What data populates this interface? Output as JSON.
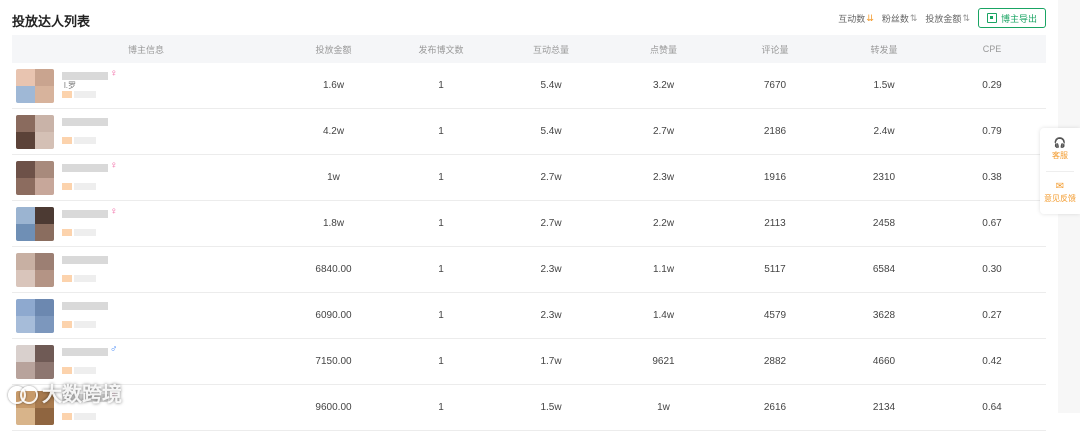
{
  "header": {
    "title": "投放达人列表",
    "sorts": [
      {
        "label": "互动数",
        "icon": "sort-desc-icon",
        "active": true
      },
      {
        "label": "粉丝数",
        "icon": "sort-icon",
        "active": false
      },
      {
        "label": "投放金额",
        "icon": "sort-icon",
        "active": false
      }
    ],
    "export_label": "博主导出"
  },
  "columns": [
    "博主信息",
    "投放金额",
    "发布博文数",
    "互动总量",
    "点赞量",
    "评论量",
    "转发量",
    "CPE"
  ],
  "rows": [
    {
      "gender": "♀",
      "name_hint": "l.罗",
      "amount": "1.6w",
      "posts": "1",
      "interactions": "5.4w",
      "likes": "3.2w",
      "comments": "7670",
      "shares": "1.5w",
      "cpe": "0.29",
      "colors": [
        "#e8c4b0",
        "#c9a48f",
        "#9fb8d6",
        "#d7b39c"
      ]
    },
    {
      "gender": "",
      "name_hint": "",
      "amount": "4.2w",
      "posts": "1",
      "interactions": "5.4w",
      "likes": "2.7w",
      "comments": "2186",
      "shares": "2.4w",
      "cpe": "0.79",
      "colors": [
        "#8a6b5e",
        "#c9b3a8",
        "#5b4238",
        "#d4c0b5"
      ]
    },
    {
      "gender": "♀",
      "name_hint": "",
      "amount": "1w",
      "posts": "1",
      "interactions": "2.7w",
      "likes": "2.3w",
      "comments": "1916",
      "shares": "2310",
      "cpe": "0.38",
      "colors": [
        "#6d5148",
        "#a88a7c",
        "#8c6c5f",
        "#c7a79a"
      ]
    },
    {
      "gender": "♀",
      "name_hint": "",
      "amount": "1.8w",
      "posts": "1",
      "interactions": "2.7w",
      "likes": "2.2w",
      "comments": "2113",
      "shares": "2458",
      "cpe": "0.67",
      "colors": [
        "#9bb4d1",
        "#4c3a33",
        "#6f8fb5",
        "#8a6d5f"
      ]
    },
    {
      "gender": "",
      "name_hint": "",
      "amount": "6840.00",
      "posts": "1",
      "interactions": "2.3w",
      "likes": "1.1w",
      "comments": "5117",
      "shares": "6584",
      "cpe": "0.30",
      "colors": [
        "#c8b0a3",
        "#9c7f73",
        "#d9c5bb",
        "#b49485"
      ]
    },
    {
      "gender": "",
      "name_hint": "",
      "amount": "6090.00",
      "posts": "1",
      "interactions": "2.3w",
      "likes": "1.4w",
      "comments": "4579",
      "shares": "3628",
      "cpe": "0.27",
      "colors": [
        "#8ea9cf",
        "#6c88b0",
        "#a6bcd9",
        "#7c97bd"
      ]
    },
    {
      "gender": "♂",
      "name_hint": "",
      "amount": "7150.00",
      "posts": "1",
      "interactions": "1.7w",
      "likes": "9621",
      "comments": "2882",
      "shares": "4660",
      "cpe": "0.42",
      "colors": [
        "#d9d0cd",
        "#6f5a55",
        "#b8a39c",
        "#8d7670"
      ]
    },
    {
      "gender": "♀",
      "name_hint": "",
      "amount": "9600.00",
      "posts": "1",
      "interactions": "1.5w",
      "likes": "1w",
      "comments": "2616",
      "shares": "2134",
      "cpe": "0.64",
      "colors": [
        "#c79a6a",
        "#a87a4e",
        "#d8b48a",
        "#8f6540"
      ]
    }
  ],
  "side_panel": {
    "items": [
      {
        "label": "客服",
        "icon": "headset-icon"
      },
      {
        "label": "意见反馈",
        "icon": "feedback-icon"
      }
    ]
  },
  "watermark": {
    "text": "大数跨境"
  }
}
